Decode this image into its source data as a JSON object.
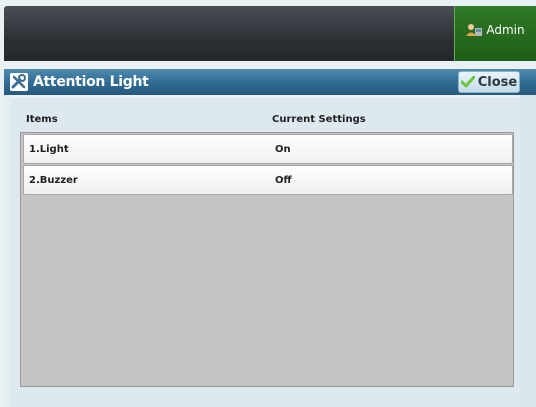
{
  "header": {
    "admin_label": "Admin",
    "admin_icon": "admin-user-icon"
  },
  "window": {
    "title": "Attention Light",
    "title_icon": "tools-icon",
    "close_label": "Close",
    "close_icon": "checkmark-icon"
  },
  "table": {
    "columns": [
      "Items",
      "Current Settings"
    ],
    "rows": [
      {
        "item": "1.Light",
        "setting": "On"
      },
      {
        "item": "2.Buzzer",
        "setting": "Off"
      }
    ]
  },
  "colors": {
    "header_bar": "#2d3136",
    "admin_button": "#1e5e18",
    "title_bar": "#2f6a92",
    "list_background": "#c4c4c4",
    "check_green": "#6cc43a"
  }
}
